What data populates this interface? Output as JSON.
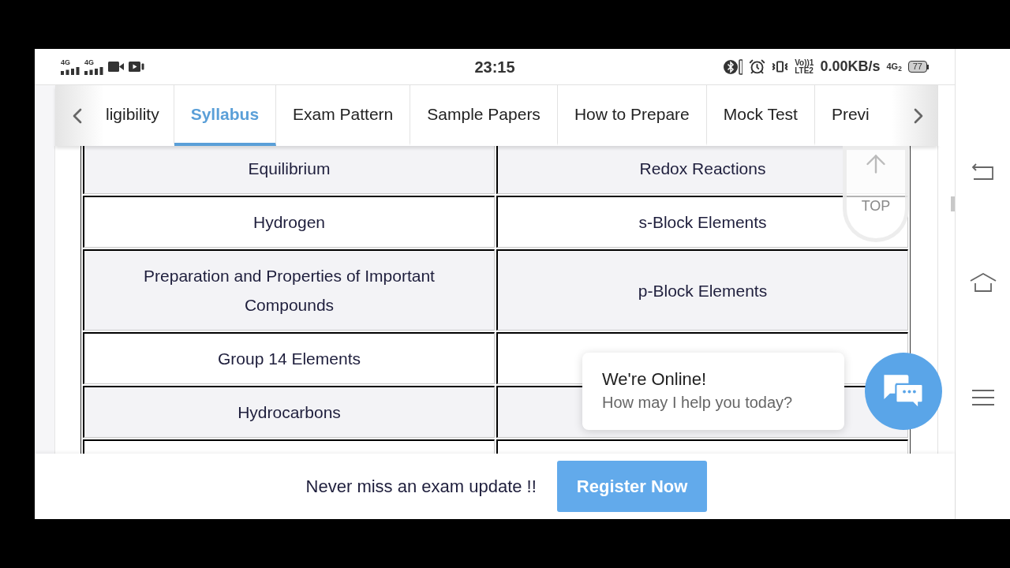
{
  "status_bar": {
    "networks": [
      {
        "label": "4G"
      },
      {
        "label": "4G"
      }
    ],
    "time": "23:15",
    "volte": {
      "line_1": "Vo))1",
      "line_2": "LTE2"
    },
    "speed": "0.00KB/s",
    "network_2": "4G$_{2}$",
    "battery": "77"
  },
  "tabs": [
    {
      "label": "ligibility",
      "selected": false
    },
    {
      "label": "Syllabus",
      "selected": true
    },
    {
      "label": "Exam Pattern",
      "selected": false
    },
    {
      "label": "Sample Papers",
      "selected": false
    },
    {
      "label": "How to Prepare",
      "selected": false
    },
    {
      "label": "Mock Test",
      "selected": false
    },
    {
      "label": "Previ",
      "selected": false
    }
  ],
  "scroll_top": {
    "label": "TOP"
  },
  "table": {
    "rows": [
      {
        "cells": [
          "Equilibrium",
          "Redox Reactions"
        ]
      },
      {
        "cells": [
          "Hydrogen",
          "s-Block Elements"
        ]
      },
      {
        "cells": [
          "Preparation and Properties of Important Compounds",
          "p-Block Elements"
        ]
      },
      {
        "cells": [
          "Group 14 Elements"
        ]
      },
      {
        "cells": [
          "Hydrocarbons"
        ]
      }
    ]
  },
  "chat": {
    "title": "We're Online!",
    "message": "How may I help you today?"
  },
  "footer": {
    "text": "Never miss an exam update !!",
    "button": "Register Now"
  }
}
